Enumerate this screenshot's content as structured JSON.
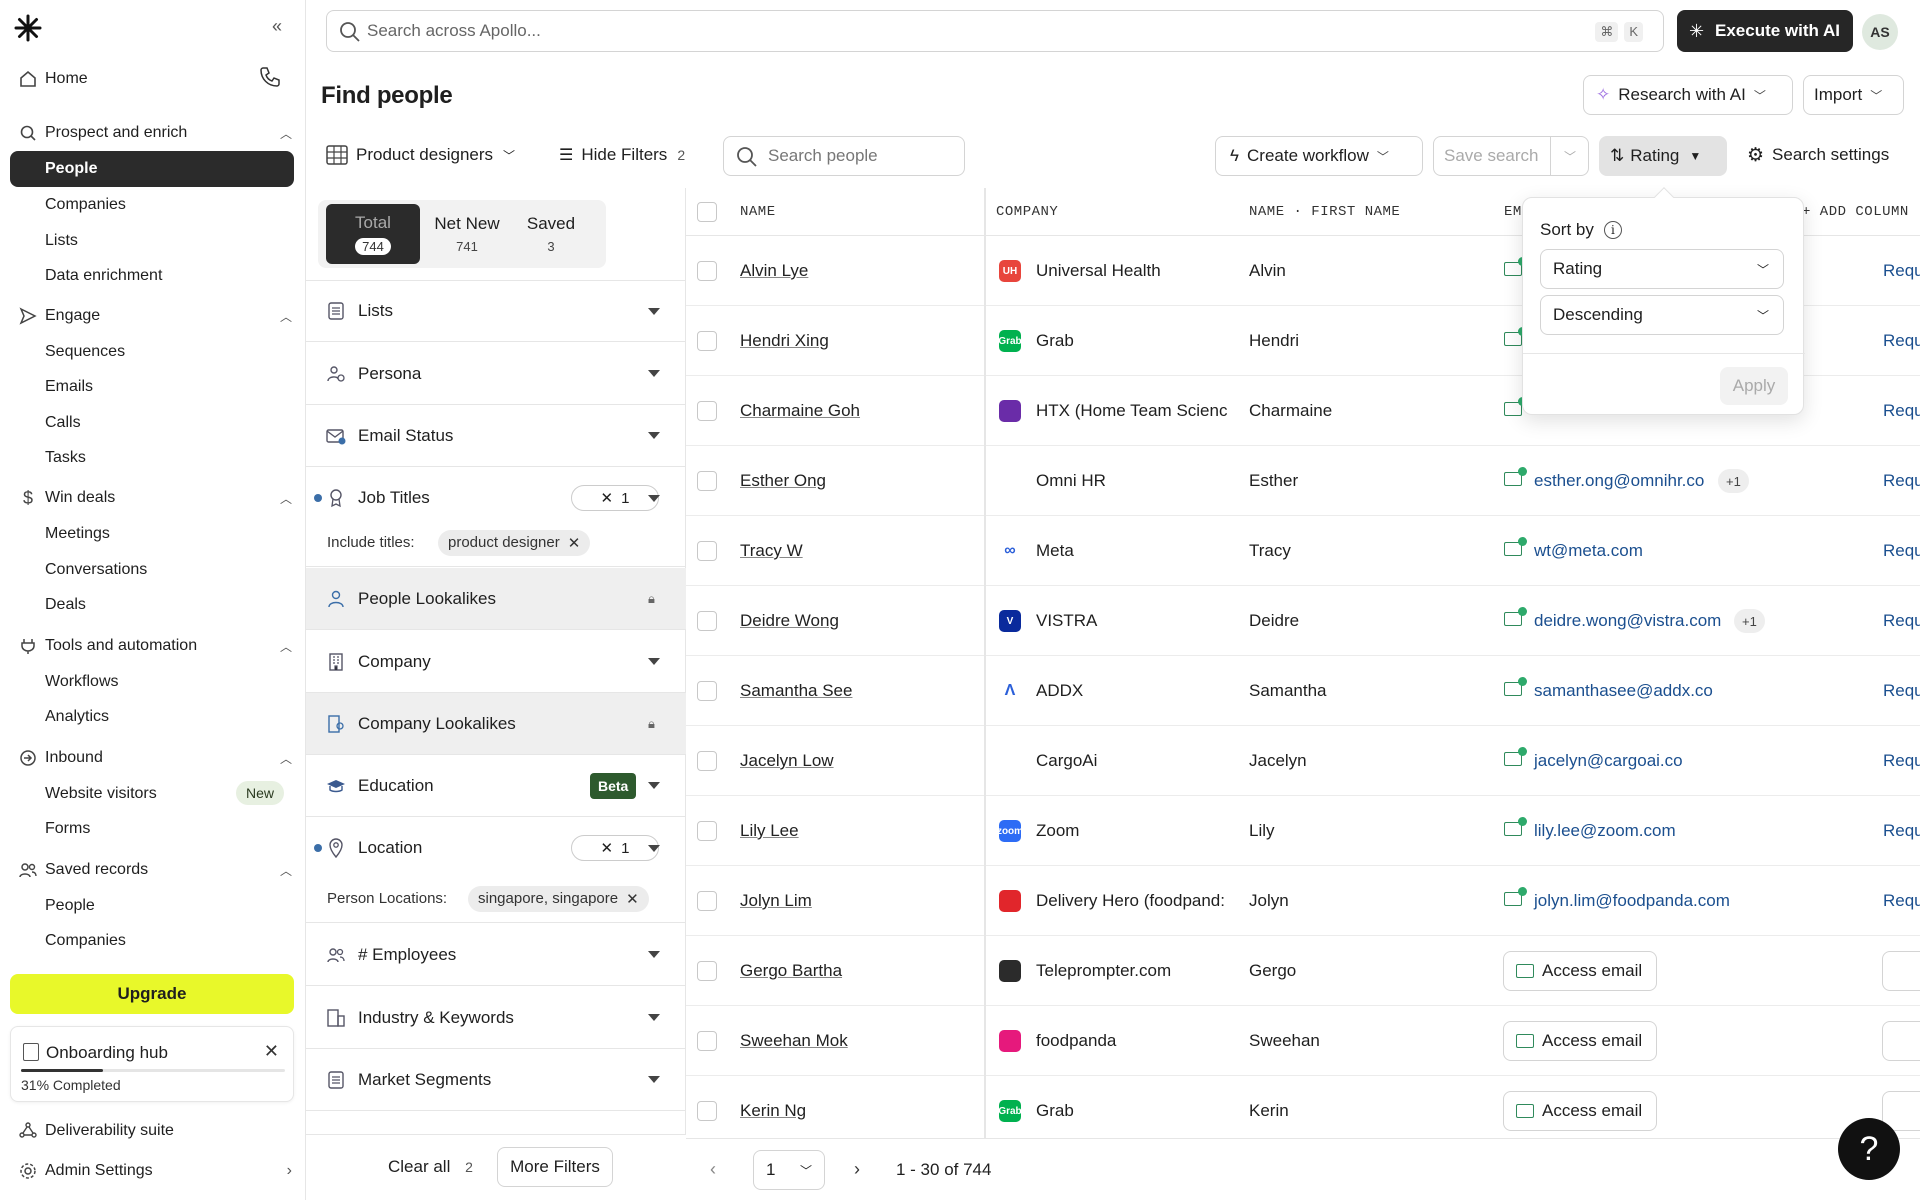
{
  "sidebar": {
    "home": "Home",
    "prospect": "Prospect and enrich",
    "prospect_items": [
      "People",
      "Companies",
      "Lists",
      "Data enrichment"
    ],
    "engage": "Engage",
    "engage_items": [
      "Sequences",
      "Emails",
      "Calls",
      "Tasks"
    ],
    "win": "Win deals",
    "win_items": [
      "Meetings",
      "Conversations",
      "Deals"
    ],
    "tools": "Tools and automation",
    "tools_items": [
      "Workflows",
      "Analytics"
    ],
    "inbound": "Inbound",
    "inbound_items": [
      "Website visitors",
      "Forms"
    ],
    "new_badge": "New",
    "saved": "Saved records",
    "saved_items": [
      "People",
      "Companies"
    ],
    "upgrade": "Upgrade",
    "onboarding": {
      "title": "Onboarding hub",
      "progress_percent": 31,
      "label": "31% Completed"
    },
    "deliverability": "Deliverability suite",
    "admin": "Admin Settings"
  },
  "topbar": {
    "search_placeholder": "Search across Apollo...",
    "kbd1": "⌘",
    "kbd2": "K",
    "execute": "Execute with AI",
    "avatar": "AS"
  },
  "page": {
    "title": "Find people",
    "research": "Research with AI",
    "import": "Import"
  },
  "toolbar": {
    "saved_view": "Product designers",
    "hide_filters": "Hide Filters",
    "hide_filters_count": "2",
    "search_people": "Search people",
    "create_workflow": "Create workflow",
    "save_search": "Save search",
    "sort": "Rating",
    "search_settings": "Search settings"
  },
  "filters": {
    "tabs": [
      {
        "label": "Total",
        "count": "744"
      },
      {
        "label": "Net New",
        "count": "741"
      },
      {
        "label": "Saved",
        "count": "3"
      }
    ],
    "lists": "Lists",
    "persona": "Persona",
    "email_status": "Email Status",
    "job_titles": "Job Titles",
    "job_titles_count": "1",
    "include_titles_label": "Include titles:",
    "include_titles_chip": "product designer",
    "people_lookalikes": "People Lookalikes",
    "company": "Company",
    "company_lookalikes": "Company Lookalikes",
    "education": "Education",
    "beta": "Beta",
    "location": "Location",
    "location_count": "1",
    "person_locations_label": "Person Locations:",
    "person_locations_chip": "singapore, singapore",
    "employees": "# Employees",
    "industry": "Industry & Keywords",
    "market": "Market Segments",
    "clear_all": "Clear all",
    "clear_count": "2",
    "more_filters": "More Filters"
  },
  "table": {
    "headers": {
      "name": "NAME",
      "company": "COMPANY",
      "first_name": "NAME · FIRST NAME",
      "email": "EM",
      "add_column": "+ ADD COLUMN"
    },
    "request": "Requ",
    "access_email": "Access email",
    "rows": [
      {
        "name": "Alvin Lye",
        "company": "Universal Health",
        "logo": "UH",
        "logo_color": "#e8453c",
        "first": "Alvin",
        "email": "",
        "plus": ""
      },
      {
        "name": "Hendri Xing",
        "company": "Grab",
        "logo": "Grab",
        "logo_color": "#00b14f",
        "first": "Hendri",
        "email": "",
        "plus": ""
      },
      {
        "name": "Charmaine Goh",
        "company": "HTX (Home Team Scienc",
        "logo": "",
        "logo_color": "#6a2ca8",
        "first": "Charmaine",
        "email": "",
        "plus": ""
      },
      {
        "name": "Esther Ong",
        "company": "Omni HR",
        "logo": "",
        "logo_color": "#ffffff",
        "first": "Esther",
        "email": "esther.ong@omnihr.co",
        "plus": "+1"
      },
      {
        "name": "Tracy W",
        "company": "Meta",
        "logo": "∞",
        "logo_color": "#ffffff",
        "first": "Tracy",
        "email": "wt@meta.com",
        "plus": ""
      },
      {
        "name": "Deidre Wong",
        "company": "VISTRA",
        "logo": "V",
        "logo_color": "#0a2a9c",
        "first": "Deidre",
        "email": "deidre.wong@vistra.com",
        "plus": "+1"
      },
      {
        "name": "Samantha See",
        "company": "ADDX",
        "logo": "Λ",
        "logo_color": "#ffffff",
        "first": "Samantha",
        "email": "samanthasee@addx.co",
        "plus": ""
      },
      {
        "name": "Jacelyn Low",
        "company": "CargoAi",
        "logo": "",
        "logo_color": "#ffffff",
        "first": "Jacelyn",
        "email": "jacelyn@cargoai.co",
        "plus": ""
      },
      {
        "name": "Lily Lee",
        "company": "Zoom",
        "logo": "zoom",
        "logo_color": "#2d6cf5",
        "first": "Lily",
        "email": "lily.lee@zoom.com",
        "plus": ""
      },
      {
        "name": "Jolyn Lim",
        "company": "Delivery Hero (foodpand:",
        "logo": "",
        "logo_color": "#e1262b",
        "first": "Jolyn",
        "email": "jolyn.lim@foodpanda.com",
        "plus": ""
      },
      {
        "name": "Gergo Bartha",
        "company": "Teleprompter.com",
        "logo": "",
        "logo_color": "#2b2b2b",
        "first": "Gergo",
        "email": "",
        "plus": ""
      },
      {
        "name": "Sweehan Mok",
        "company": "foodpanda",
        "logo": "",
        "logo_color": "#e6197c",
        "first": "Sweehan",
        "email": "",
        "plus": ""
      },
      {
        "name": "Kerin Ng",
        "company": "Grab",
        "logo": "Grab",
        "logo_color": "#00b14f",
        "first": "Kerin",
        "email": "",
        "plus": ""
      }
    ]
  },
  "pager": {
    "page": "1",
    "range": "1 - 30 of 744"
  },
  "sort_popover": {
    "title": "Sort by",
    "field": "Rating",
    "order": "Descending",
    "apply": "Apply"
  },
  "help": "?"
}
